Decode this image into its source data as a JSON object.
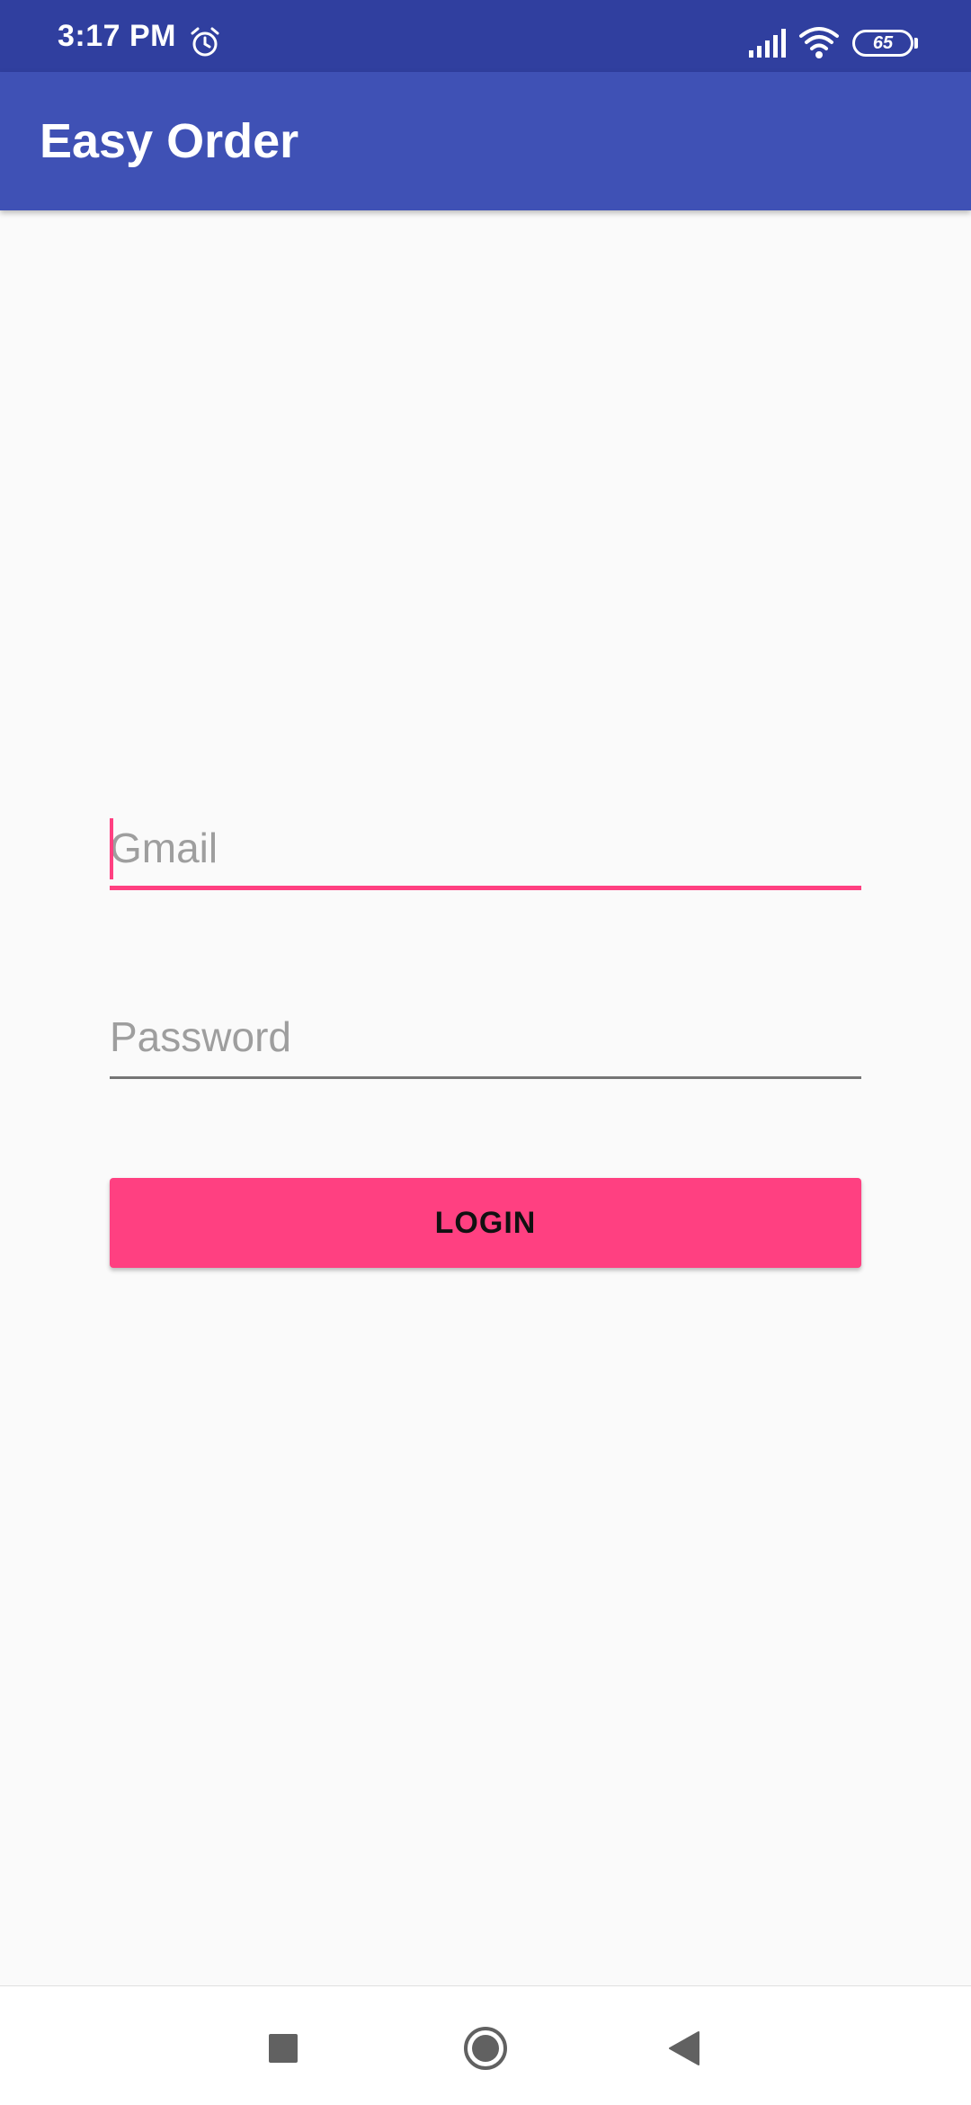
{
  "status_bar": {
    "time": "3:17 PM",
    "battery_level": "65",
    "icons": [
      "alarm-icon",
      "signal-icon",
      "wifi-icon",
      "battery-icon"
    ]
  },
  "app_bar": {
    "title": "Easy Order"
  },
  "login_form": {
    "gmail_placeholder": "Gmail",
    "gmail_value": "",
    "password_placeholder": "Password",
    "password_value": "",
    "login_label": "LOGIN"
  },
  "nav_bar": {
    "icons": [
      "recents-icon",
      "home-icon",
      "back-icon"
    ]
  },
  "colors": {
    "status_bar": "#303f9f",
    "app_bar": "#3f51b5",
    "accent": "#ff4081",
    "background": "#fafafa"
  }
}
